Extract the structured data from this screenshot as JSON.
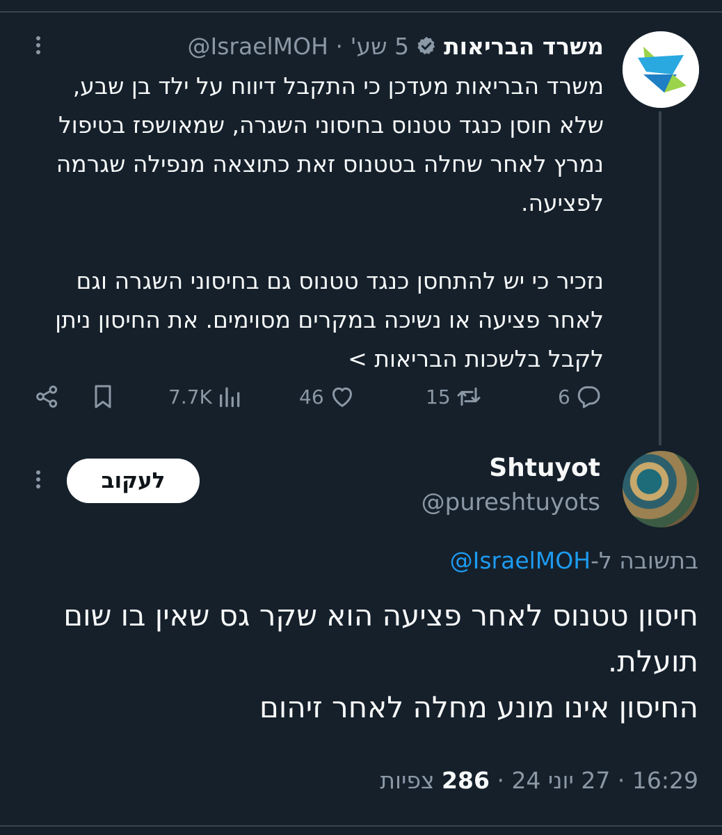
{
  "parent_tweet": {
    "author_name": "משרד הבריאות",
    "verified_icon": "verified-badge-icon",
    "handle": "@IsraelMOH",
    "separator": "·",
    "time_ago": "5 שע'",
    "paragraph1": "משרד הבריאות מעדכן כי התקבל דיווח על ילד בן שבע, שלא חוסן כנגד טטנוס בחיסוני השגרה, שמאושפז בטיפול נמרץ  לאחר שחלה בטטנוס זאת כתוצאה מנפילה שגרמה לפציעה.",
    "paragraph2": "נזכיר כי יש להתחסן כנגד טטנוס גם בחיסוני השגרה וגם לאחר פציעה או נשיכה במקרים מסוימים. את החיסון ניתן לקבל בלשכות הבריאות >",
    "actions": {
      "replies": "6",
      "retweets": "15",
      "likes": "46",
      "views": "7.7K"
    }
  },
  "reply_tweet": {
    "author_name": "Shtuyot",
    "handle": "@pureshtuyots",
    "follow_label": "לעקוב",
    "replying_to_prefix": "בתשובה ל-",
    "replying_to_handle": "@IsraelMOH",
    "line1": "חיסון טטנוס לאחר פציעה הוא שקר גס שאין בו שום תועלת.",
    "line2": "החיסון אינו מונע מחלה לאחר זיהום",
    "footer": {
      "time": "16:29",
      "date": "27 יוני 24",
      "separator": "·",
      "views_count": "286",
      "views_label": "צפיות"
    }
  },
  "colors": {
    "background": "#15202b",
    "text": "#f7f9f9",
    "muted": "#8b98a5",
    "link": "#1d9bf0",
    "divider": "#38444d"
  }
}
